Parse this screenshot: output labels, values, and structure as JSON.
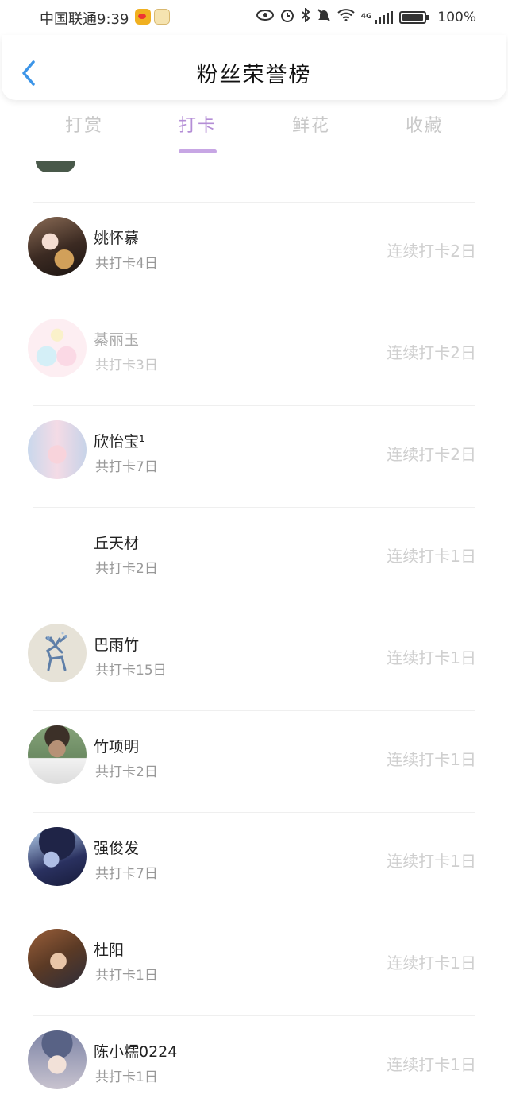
{
  "status_bar": {
    "carrier_time": "中国联通9:39",
    "network": "4G",
    "battery": "100%",
    "icons": [
      "weibo-icon",
      "anime-app-icon",
      "eye-icon",
      "alarm-icon",
      "bluetooth-icon",
      "mute-icon",
      "wifi-icon",
      "signal-icon",
      "battery-icon"
    ]
  },
  "header": {
    "title": "粉丝荣誉榜",
    "back_icon": "chevron-left-icon"
  },
  "tabs": [
    {
      "label": "打赏",
      "active": false
    },
    {
      "label": "打卡",
      "active": true
    },
    {
      "label": "鲜花",
      "active": false
    },
    {
      "label": "收藏",
      "active": false
    }
  ],
  "colors": {
    "accent": "#b48ed6",
    "back_icon": "#3d95e8",
    "muted_text": "#999999",
    "streak_text": "#cfcfcf"
  },
  "fans": [
    {
      "name": "姚怀慕",
      "total": "共打卡4日",
      "streak": "连续打卡2日",
      "faded": false
    },
    {
      "name": "綦丽玉",
      "total": "共打卡3日",
      "streak": "连续打卡2日",
      "faded": true
    },
    {
      "name": "欣怡宝¹",
      "total": "共打卡7日",
      "streak": "连续打卡2日",
      "faded": false
    },
    {
      "name": "丘天材",
      "total": "共打卡2日",
      "streak": "连续打卡1日",
      "faded": false
    },
    {
      "name": "巴雨竹",
      "total": "共打卡15日",
      "streak": "连续打卡1日",
      "faded": false
    },
    {
      "name": "竹项明",
      "total": "共打卡2日",
      "streak": "连续打卡1日",
      "faded": false
    },
    {
      "name": "强俊发",
      "total": "共打卡7日",
      "streak": "连续打卡1日",
      "faded": false
    },
    {
      "name": "杜阳",
      "total": "共打卡1日",
      "streak": "连续打卡1日",
      "faded": false
    },
    {
      "name": "陈小糯0224",
      "total": "共打卡1日",
      "streak": "连续打卡1日",
      "faded": false
    }
  ]
}
